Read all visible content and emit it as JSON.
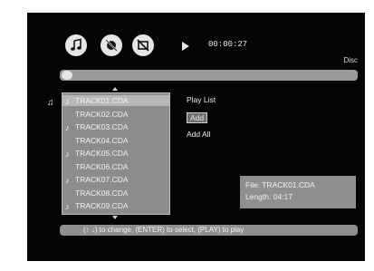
{
  "player": {
    "time": "00:00:27",
    "source": "Disc",
    "icons": [
      "music-note-icon",
      "no-audio-icon",
      "no-video-icon",
      "play-icon"
    ]
  },
  "tracks": [
    {
      "label": "TRACK01.CDA",
      "selected": true
    },
    {
      "label": "TRACK02.CDA",
      "selected": false
    },
    {
      "label": "TRACK03.CDA",
      "selected": false
    },
    {
      "label": "TRACK04.CDA",
      "selected": false
    },
    {
      "label": "TRACK05.CDA",
      "selected": false
    },
    {
      "label": "TRACK06.CDA",
      "selected": false
    },
    {
      "label": "TRACK07.CDA",
      "selected": false
    },
    {
      "label": "TRACK08.CDA",
      "selected": false
    },
    {
      "label": "TRACK09.CDA",
      "selected": false
    }
  ],
  "commands": {
    "play_list": "Play List",
    "add": "Add",
    "add_all": "Add All"
  },
  "info": {
    "file": "File: TRACK01.CDA",
    "length": "Length: 04:17"
  },
  "hint": "(↑ ↓) to change, (ENTER) to select, (PLAY) to play"
}
